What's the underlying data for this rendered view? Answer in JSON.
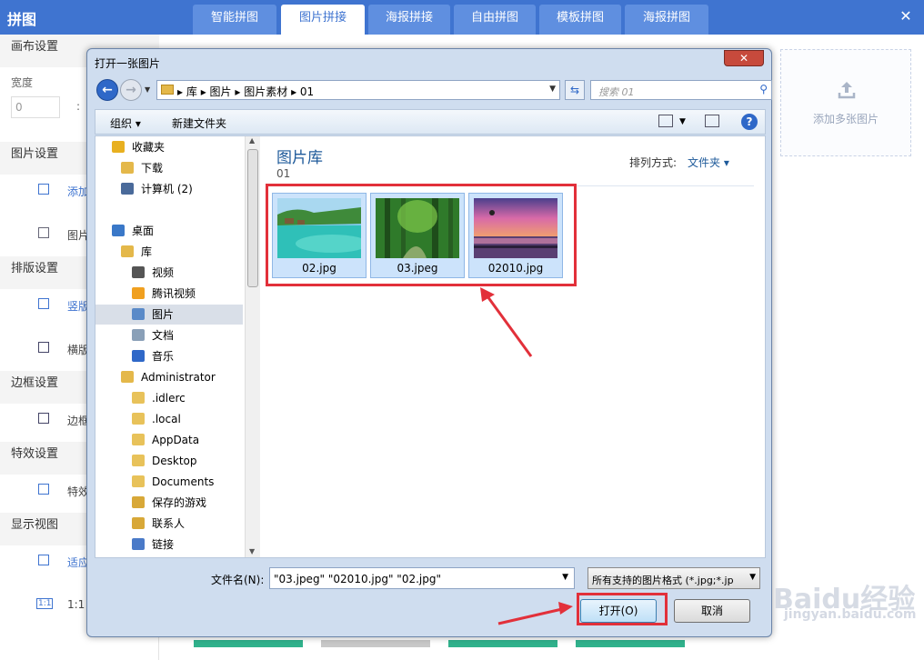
{
  "app": {
    "title": "拼图",
    "close": "✕",
    "tabs": [
      "智能拼图",
      "图片拼接",
      "海报拼接",
      "自由拼图",
      "模板拼图",
      "海报拼图"
    ],
    "active_tab": "图片拼接"
  },
  "sidebar": {
    "canvas_section": "画布设置",
    "width_label": "宽度",
    "width_value": "0",
    "width_sep": ":",
    "image_section": "图片设置",
    "image_items": [
      "添加",
      "图片"
    ],
    "layout_section": "排版设置",
    "layout_items": [
      "竖版",
      "横版"
    ],
    "border_section": "边框设置",
    "border_items": [
      "边框"
    ],
    "effect_section": "特效设置",
    "effect_items": [
      "特效"
    ],
    "view_section": "显示视图",
    "view_items": [
      "适应",
      "1:1"
    ],
    "view_icon_text": "1:1"
  },
  "right_panel": {
    "add_multi_label": "添加多张图片"
  },
  "dialog": {
    "title": "打开一张图片",
    "close": "✕",
    "breadcrumb": [
      "库",
      "图片",
      "图片素材",
      "01"
    ],
    "search_placeholder": "搜索 01",
    "toolbar": {
      "organize": "组织",
      "new_folder": "新建文件夹"
    },
    "nav_tree": [
      {
        "label": "收藏夹",
        "icon": "star-icon",
        "indent": 0
      },
      {
        "label": "下载",
        "icon": "download-folder-icon",
        "indent": 1
      },
      {
        "label": "计算机 (2)",
        "icon": "computer-icon",
        "indent": 1
      },
      {
        "label": "桌面",
        "icon": "desktop-icon",
        "indent": 0
      },
      {
        "label": "库",
        "icon": "library-icon",
        "indent": 1
      },
      {
        "label": "视频",
        "icon": "video-icon",
        "indent": 2
      },
      {
        "label": "腾讯视频",
        "icon": "tencent-video-icon",
        "indent": 2
      },
      {
        "label": "图片",
        "icon": "pictures-icon",
        "indent": 2,
        "selected": true
      },
      {
        "label": "文档",
        "icon": "documents-icon",
        "indent": 2
      },
      {
        "label": "音乐",
        "icon": "music-icon",
        "indent": 2
      },
      {
        "label": "Administrator",
        "icon": "user-folder-icon",
        "indent": 1
      },
      {
        "label": ".idlerc",
        "icon": "folder-icon",
        "indent": 2
      },
      {
        "label": ".local",
        "icon": "folder-icon",
        "indent": 2
      },
      {
        "label": "AppData",
        "icon": "folder-icon",
        "indent": 2
      },
      {
        "label": "Desktop",
        "icon": "folder-icon",
        "indent": 2
      },
      {
        "label": "Documents",
        "icon": "folder-icon",
        "indent": 2
      },
      {
        "label": "保存的游戏",
        "icon": "saved-games-icon",
        "indent": 2
      },
      {
        "label": "联系人",
        "icon": "contacts-icon",
        "indent": 2
      },
      {
        "label": "链接",
        "icon": "links-icon",
        "indent": 2
      }
    ],
    "library_title": "图片库",
    "library_sub": "01",
    "sort_label": "排列方式:",
    "sort_value": "文件夹 ▾",
    "files": [
      "02.jpg",
      "03.jpeg",
      "02010.jpg"
    ],
    "filename_label": "文件名(N):",
    "filename_value": "\"03.jpeg\" \"02010.jpg\" \"02.jpg\"",
    "filter_value": "所有支持的图片格式 (*.jpg;*.jp",
    "open_button": "打开(O)",
    "cancel_button": "取消"
  },
  "watermark": {
    "main": "Baidu经验",
    "sub": "jingyan.baidu.com"
  },
  "colors": {
    "app_blue": "#3f74d0",
    "annotation_red": "#e2303a",
    "thumb_selected": "#cce3fb"
  }
}
